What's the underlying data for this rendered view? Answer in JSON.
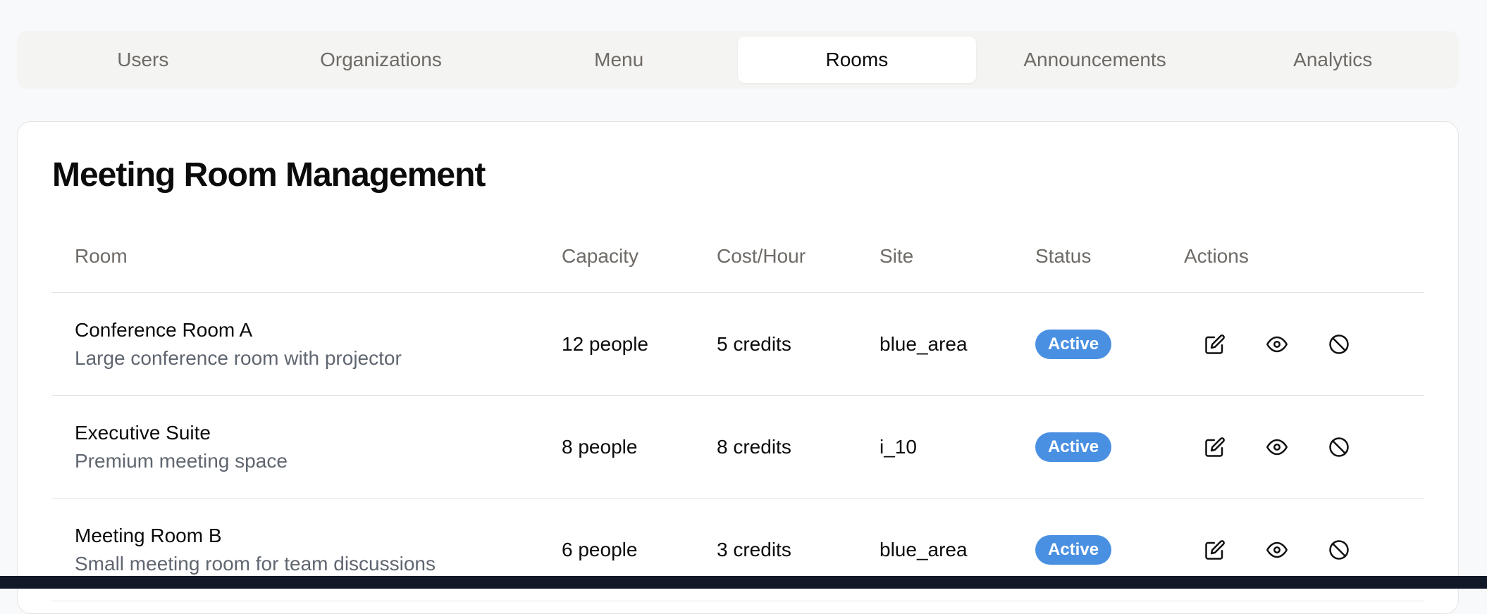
{
  "tabs": [
    {
      "label": "Users",
      "active": false
    },
    {
      "label": "Organizations",
      "active": false
    },
    {
      "label": "Menu",
      "active": false
    },
    {
      "label": "Rooms",
      "active": true
    },
    {
      "label": "Announcements",
      "active": false
    },
    {
      "label": "Analytics",
      "active": false
    }
  ],
  "page": {
    "title": "Meeting Room Management"
  },
  "table": {
    "headers": {
      "room": "Room",
      "capacity": "Capacity",
      "cost": "Cost/Hour",
      "site": "Site",
      "status": "Status",
      "actions": "Actions"
    },
    "rows": [
      {
        "name": "Conference Room A",
        "description": "Large conference room with projector",
        "capacity": "12 people",
        "cost": "5 credits",
        "site": "blue_area",
        "status": "Active"
      },
      {
        "name": "Executive Suite",
        "description": "Premium meeting space",
        "capacity": "8 people",
        "cost": "8 credits",
        "site": "i_10",
        "status": "Active"
      },
      {
        "name": "Meeting Room B",
        "description": "Small meeting room for team discussions",
        "capacity": "6 people",
        "cost": "3 credits",
        "site": "blue_area",
        "status": "Active"
      }
    ],
    "action_icons": [
      "edit-icon",
      "eye-icon",
      "ban-icon"
    ]
  },
  "colors": {
    "status_active": "#4a90e2",
    "page_background": "#f8f9fb",
    "tab_bar_background": "#f4f4f2"
  }
}
